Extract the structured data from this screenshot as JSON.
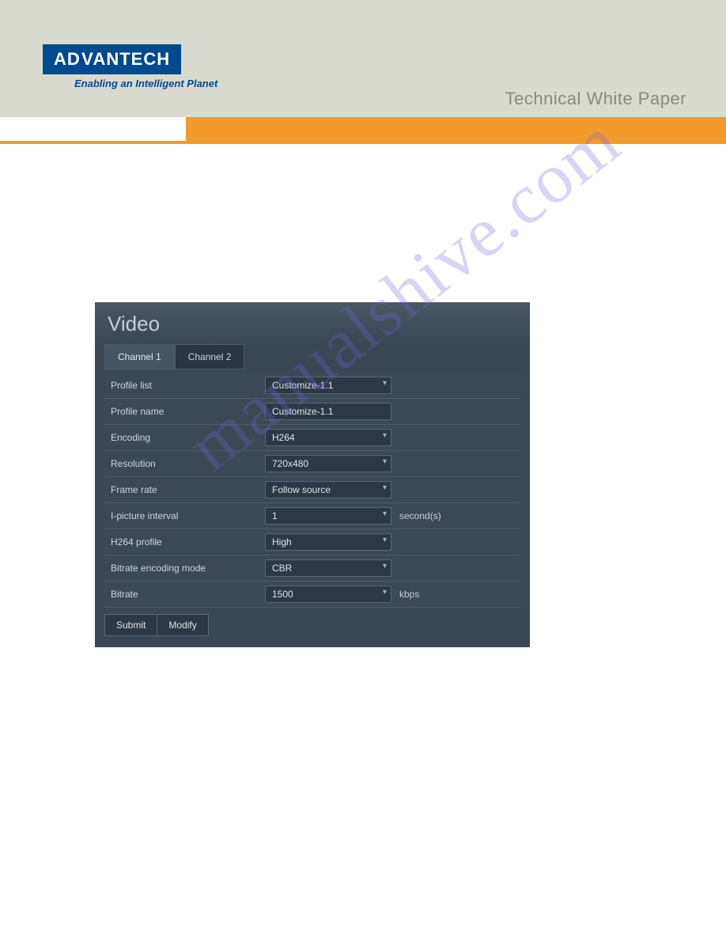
{
  "header": {
    "brand": "ADVANTECH",
    "tagline": "Enabling an Intelligent Planet",
    "doc_type": "Technical White Paper"
  },
  "watermark": "manualshive.com",
  "panel": {
    "title": "Video",
    "tabs": [
      {
        "label": "Channel 1"
      },
      {
        "label": "Channel 2"
      }
    ],
    "rows": {
      "profile_list": {
        "label": "Profile list",
        "value": "Customize-1.1"
      },
      "profile_name": {
        "label": "Profile name",
        "value": "Customize-1.1"
      },
      "encoding": {
        "label": "Encoding",
        "value": "H264"
      },
      "resolution": {
        "label": "Resolution",
        "value": "720x480"
      },
      "frame_rate": {
        "label": "Frame rate",
        "value": "Follow source"
      },
      "i_picture_interval": {
        "label": "I-picture interval",
        "value": "1",
        "suffix": "second(s)"
      },
      "h264_profile": {
        "label": "H264 profile",
        "value": "High"
      },
      "bitrate_encoding_mode": {
        "label": "Bitrate encoding mode",
        "value": "CBR"
      },
      "bitrate": {
        "label": "Bitrate",
        "value": "1500",
        "suffix": "kbps"
      }
    },
    "buttons": {
      "submit": "Submit",
      "modify": "Modify"
    }
  }
}
